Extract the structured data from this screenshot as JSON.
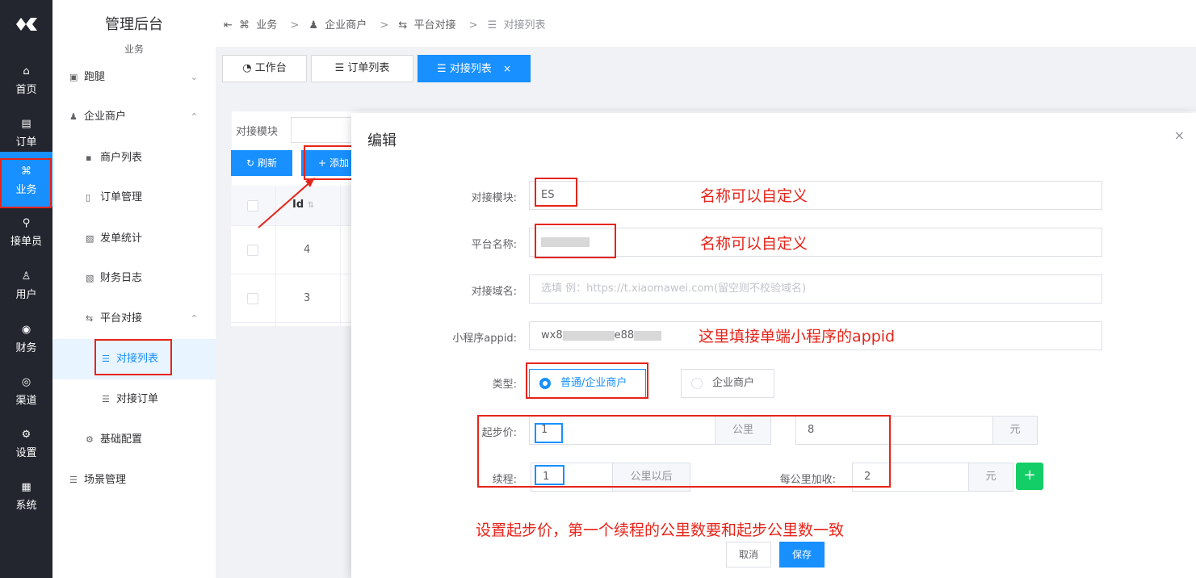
{
  "rail": {
    "items": [
      {
        "icon": "home-icon",
        "label": "首页"
      },
      {
        "icon": "order-icon",
        "label": "订单"
      },
      {
        "icon": "apps-icon",
        "label": "业务"
      },
      {
        "icon": "bike-icon",
        "label": "接单员"
      },
      {
        "icon": "user-icon",
        "label": "用户"
      },
      {
        "icon": "coin-icon",
        "label": "财务"
      },
      {
        "icon": "compass-icon",
        "label": "渠道"
      },
      {
        "icon": "gear-icon",
        "label": "设置"
      },
      {
        "icon": "system-icon",
        "label": "系统"
      }
    ],
    "active": "业务"
  },
  "menu": {
    "title": "管理后台",
    "subtitle": "业务",
    "items": [
      {
        "label": "跑腿",
        "icon": "grid-icon",
        "expanded": false
      },
      {
        "label": "企业商户",
        "icon": "users-icon",
        "expanded": true
      },
      {
        "label": "商户列表",
        "icon": "id-card-icon"
      },
      {
        "label": "订单管理",
        "icon": "document-icon"
      },
      {
        "label": "发单统计",
        "icon": "chart-icon"
      },
      {
        "label": "财务日志",
        "icon": "log-icon"
      },
      {
        "label": "平台对接",
        "icon": "swap-icon",
        "expanded": true
      },
      {
        "label": "对接列表",
        "icon": "list-icon",
        "selected": true
      },
      {
        "label": "对接订单",
        "icon": "list-icon"
      },
      {
        "label": "基础配置",
        "icon": "gear-icon"
      },
      {
        "label": "场景管理",
        "icon": "list-icon"
      }
    ]
  },
  "breadcrumb": [
    "业务",
    "企业商户",
    "平台对接",
    "对接列表"
  ],
  "tabs": [
    {
      "label": "工作台",
      "icon": "dashboard-icon"
    },
    {
      "label": "订单列表",
      "icon": "list-icon"
    },
    {
      "label": "对接列表",
      "icon": "list-icon",
      "active": true,
      "close": "×"
    }
  ],
  "page": {
    "filter_label": "对接模块",
    "refresh_label": "刷新",
    "add_label": "添加",
    "table": {
      "headers": [
        "",
        "Id"
      ],
      "rows": [
        {
          "id": "4"
        },
        {
          "id": "3"
        }
      ]
    }
  },
  "modal": {
    "title": "编辑",
    "close": "×",
    "fields": {
      "module": {
        "label": "对接模块:",
        "value": "ES"
      },
      "platform": {
        "label": "平台名称:",
        "value": ""
      },
      "domain": {
        "label": "对接域名:",
        "placeholder": "选填 例：https://t.xiaomawei.com(留空则不校验域名)"
      },
      "appid": {
        "label": "小程序appid:",
        "value_prefix": "wx8",
        "value_mid": "e88"
      },
      "type": {
        "label": "类型:",
        "options": [
          "普通/企业商户",
          "企业商户"
        ],
        "selected": "普通/企业商户"
      },
      "start_price": {
        "label": "起步价:",
        "km": "1",
        "km_unit": "公里",
        "price": "8",
        "price_unit": "元"
      },
      "continue": {
        "label": "续程:",
        "km": "1",
        "km_unit": "公里以后",
        "extra_label": "每公里加收:",
        "extra": "2",
        "extra_unit": "元",
        "add": "+"
      }
    },
    "cancel_label": "取消",
    "save_label": "保存"
  },
  "annotations": {
    "note_module": "名称可以自定义",
    "note_platform": "名称可以自定义",
    "note_appid": "这里填接单端小程序的appid",
    "note_price": "设置起步价，第一个续程的公里数要和起步公里数一致"
  },
  "colors": {
    "primary": "#1890ff",
    "success": "#13ce66",
    "annotation": "#e6241a",
    "rail": "#23262e"
  }
}
